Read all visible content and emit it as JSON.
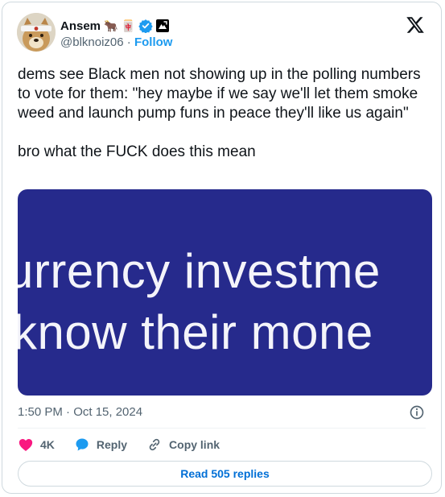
{
  "author": {
    "name": "Ansem",
    "name_emojis": [
      "🐂",
      "🀄"
    ],
    "handle": "@blknoiz06",
    "separator": " · ",
    "follow_label": "Follow"
  },
  "tweet": {
    "paragraph_1": "dems see Black men not showing up in the polling numbers to vote for them: \"hey maybe if we say we'll let them smoke weed and launch pump funs in peace they'll like us again\"",
    "paragraph_2": "bro what the FUCK does this mean"
  },
  "media": {
    "line_1": "urrency investme",
    "line_2": "know their mone",
    "background_color": "#262a8c"
  },
  "timestamp": "1:50 PM · Oct 15, 2024",
  "actions": {
    "like_count": "4K",
    "reply_label": "Reply",
    "copy_link_label": "Copy link"
  },
  "read_replies_label": "Read 505 replies",
  "colors": {
    "accent": "#1d9bf0",
    "like": "#f91880",
    "link": "#006fd6",
    "muted": "#536471"
  },
  "icons": [
    "verified-badge-icon",
    "affiliate-badge-icon",
    "x-logo-icon",
    "info-icon",
    "heart-icon",
    "reply-bubble-icon",
    "link-icon"
  ]
}
